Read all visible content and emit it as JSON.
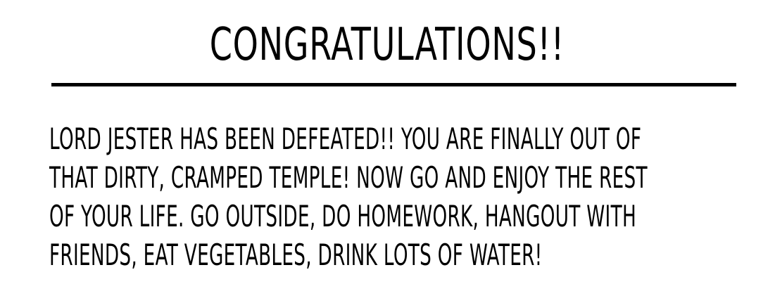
{
  "screen": {
    "title": "CONGRATULATIONS!!",
    "message_lines": [
      "LORD JESTER HAS BEEN DEFEATED!! YOU ARE FINALLY OUT OF",
      "THAT DIRTY, CRAMPED TEMPLE! NOW GO AND ENJOY THE REST",
      "OF YOUR LIFE. GO OUTSIDE, DO HOMEWORK, HANGOUT WITH",
      "FRIENDS, EAT VEGETABLES, DRINK LOTS OF WATER!"
    ]
  },
  "colors": {
    "background": "#ffffff",
    "text": "#000000",
    "divider": "#000000"
  }
}
